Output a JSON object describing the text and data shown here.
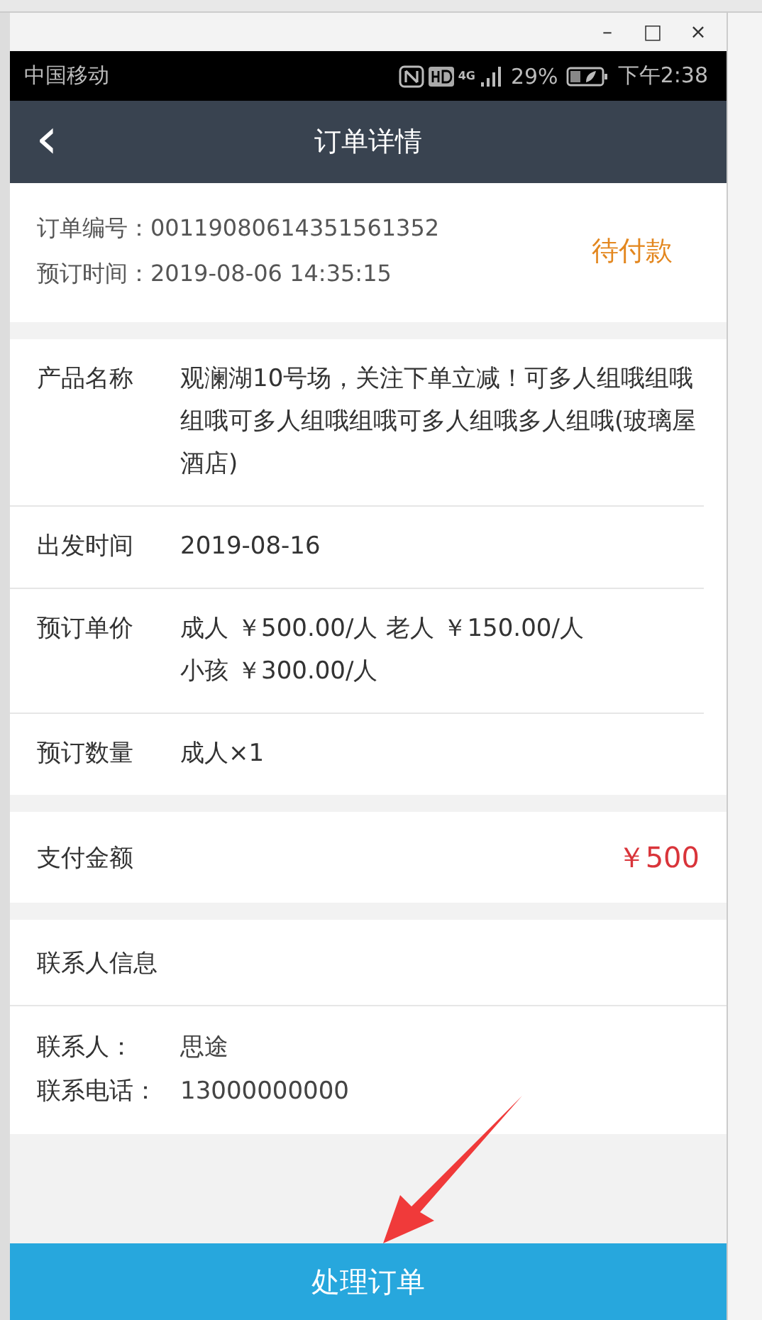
{
  "window": {
    "controls": [
      "–",
      "□",
      "×"
    ]
  },
  "status_bar": {
    "carrier": "中国移动",
    "network": "4G",
    "battery": "29%",
    "time": "下午2:38"
  },
  "header": {
    "back": "‹",
    "title": "订单详情"
  },
  "order": {
    "number_label": "订单编号：",
    "number": "00119080614351561352",
    "time_label": "预订时间：",
    "time": "2019-08-06 14:35:15",
    "status": "待付款"
  },
  "details": [
    {
      "label": "产品名称",
      "value": "观澜湖10号场，关注下单立减！可多人组哦组哦组哦可多人组哦组哦可多人组哦多人组哦(玻璃屋酒店)"
    },
    {
      "label": "出发时间",
      "value": "2019-08-16"
    },
    {
      "label": "预订单价",
      "kind": "prices",
      "prices": [
        {
          "group": "成人",
          "price": "￥500.00/人"
        },
        {
          "group": "老人",
          "price": "￥150.00/人"
        },
        {
          "group": "小孩",
          "price": "￥300.00/人"
        }
      ]
    },
    {
      "label": "预订数量",
      "value": "成人×1"
    }
  ],
  "payment": {
    "label": "支付金额",
    "amount": "￥500"
  },
  "contact": {
    "title": "联系人信息",
    "rows": [
      {
        "label": "联系人：",
        "value": "思途"
      },
      {
        "label": "联系电话：",
        "value": "13000000000"
      }
    ]
  },
  "action_button": "处理订单"
}
